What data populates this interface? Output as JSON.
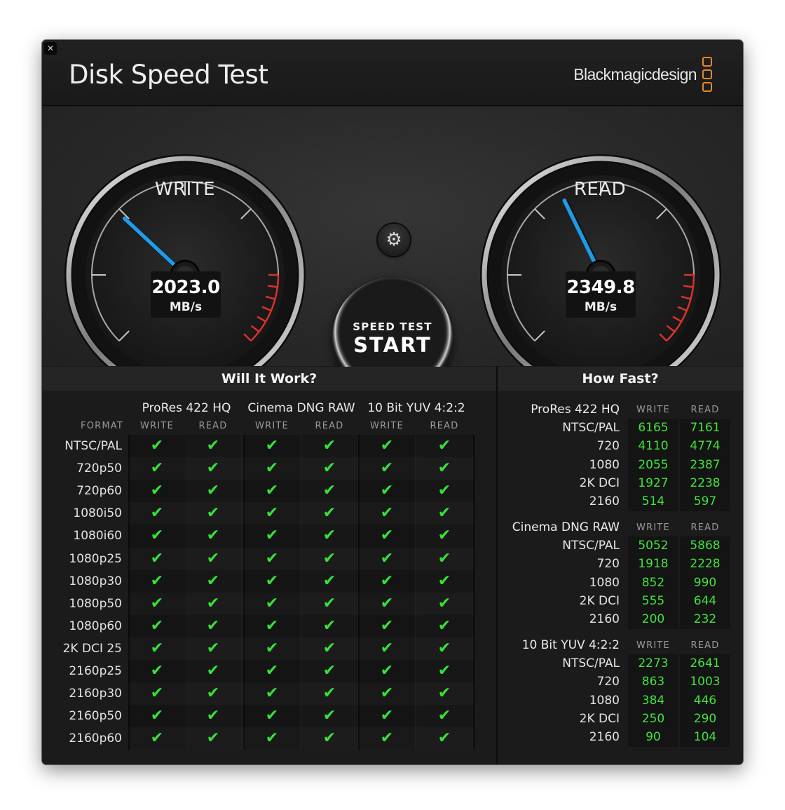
{
  "window": {
    "close_glyph": "✕"
  },
  "header": {
    "title": "Disk Speed Test",
    "brand": "Blackmagicdesign"
  },
  "gauges": {
    "write": {
      "label": "WRITE",
      "value": "2023.0",
      "unit": "MB/s"
    },
    "read": {
      "label": "READ",
      "value": "2349.8",
      "unit": "MB/s"
    }
  },
  "controls": {
    "settings_icon": "gear-icon",
    "start_line1": "SPEED TEST",
    "start_line2": "START"
  },
  "will_it_work": {
    "title": "Will It Work?",
    "format_header": "FORMAT",
    "write_header": "WRITE",
    "read_header": "READ",
    "groups": [
      "ProRes 422 HQ",
      "Cinema DNG RAW",
      "10 Bit YUV 4:2:2"
    ],
    "check_glyph": "✔",
    "formats": [
      "NTSC/PAL",
      "720p50",
      "720p60",
      "1080i50",
      "1080i60",
      "1080p25",
      "1080p30",
      "1080p50",
      "1080p60",
      "2K DCI 25",
      "2160p25",
      "2160p30",
      "2160p50",
      "2160p60"
    ]
  },
  "how_fast": {
    "title": "How Fast?",
    "write_header": "WRITE",
    "read_header": "READ",
    "sections": [
      {
        "name": "ProRes 422 HQ",
        "rows": [
          {
            "format": "NTSC/PAL",
            "write": "6165",
            "read": "7161"
          },
          {
            "format": "720",
            "write": "4110",
            "read": "4774"
          },
          {
            "format": "1080",
            "write": "2055",
            "read": "2387"
          },
          {
            "format": "2K DCI",
            "write": "1927",
            "read": "2238"
          },
          {
            "format": "2160",
            "write": "514",
            "read": "597"
          }
        ]
      },
      {
        "name": "Cinema DNG RAW",
        "rows": [
          {
            "format": "NTSC/PAL",
            "write": "5052",
            "read": "5868"
          },
          {
            "format": "720",
            "write": "1918",
            "read": "2228"
          },
          {
            "format": "1080",
            "write": "852",
            "read": "990"
          },
          {
            "format": "2K DCI",
            "write": "555",
            "read": "644"
          },
          {
            "format": "2160",
            "write": "200",
            "read": "232"
          }
        ]
      },
      {
        "name": "10 Bit YUV 4:2:2",
        "rows": [
          {
            "format": "NTSC/PAL",
            "write": "2273",
            "read": "2641"
          },
          {
            "format": "720",
            "write": "863",
            "read": "1003"
          },
          {
            "format": "1080",
            "write": "384",
            "read": "446"
          },
          {
            "format": "2K DCI",
            "write": "250",
            "read": "290"
          },
          {
            "format": "2160",
            "write": "90",
            "read": "104"
          }
        ]
      }
    ]
  },
  "colors": {
    "accent": "#1e9be8",
    "check": "#39e03a",
    "redzone": "#d8322e",
    "brand_orange": "#e08a2a"
  }
}
